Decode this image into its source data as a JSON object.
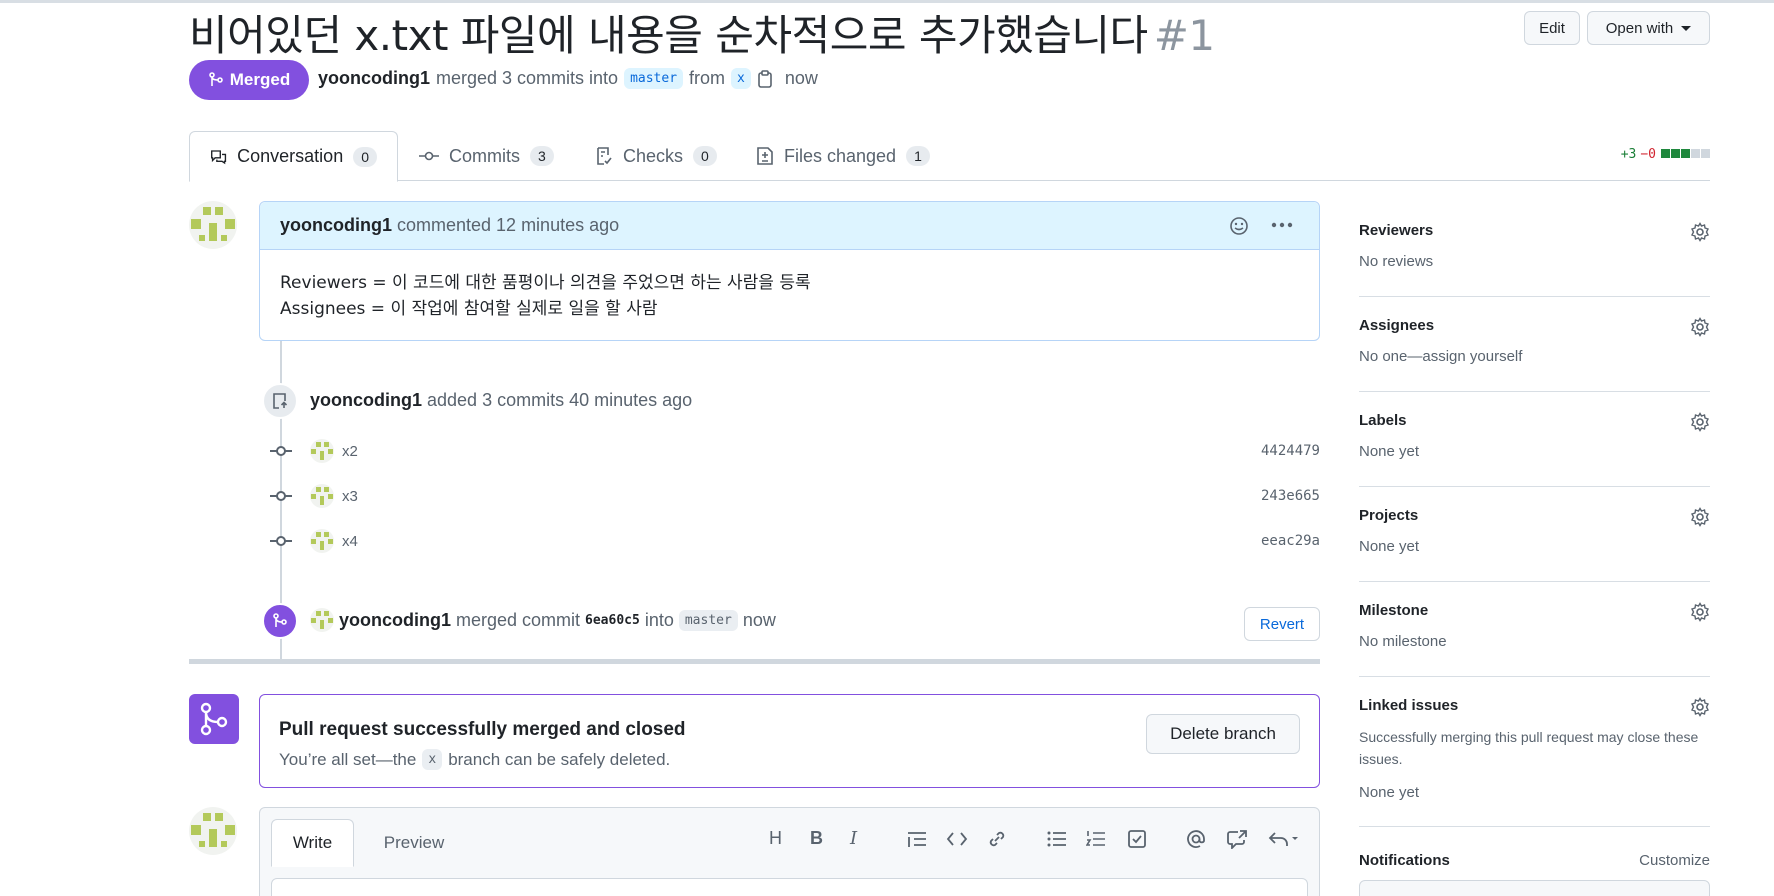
{
  "header": {
    "title": "비어있던 x.txt 파일에 내용을 순차적으로 추가했습니다",
    "number": "#1",
    "edit_label": "Edit",
    "open_with_label": "Open with"
  },
  "status": {
    "badge": "Merged",
    "author": "yooncoding1",
    "merged_text": "merged 3 commits into",
    "base_branch": "master",
    "from_text": "from",
    "head_branch": "x",
    "time": "now"
  },
  "tabs": [
    {
      "label": "Conversation",
      "count": "0"
    },
    {
      "label": "Commits",
      "count": "3"
    },
    {
      "label": "Checks",
      "count": "0"
    },
    {
      "label": "Files changed",
      "count": "1"
    }
  ],
  "diffstat": {
    "additions": "+3",
    "deletions": "−0",
    "green_blocks": 3,
    "gray_blocks": 2,
    "green": "#1f883d",
    "gray": "#d0d7de"
  },
  "comment": {
    "author": "yooncoding1",
    "action": "commented 12 minutes ago",
    "lines": [
      "Reviewers = 이 코드에 대한 품평이나 의견을 주었으면 하는 사람을 등록",
      "Assignees = 이 작업에 참여할 실제로 일을 할 사람"
    ]
  },
  "commits_event": {
    "author": "yooncoding1",
    "text": "added 3 commits 40 minutes ago",
    "commits": [
      {
        "message": "x2",
        "sha": "4424479"
      },
      {
        "message": "x3",
        "sha": "243e665"
      },
      {
        "message": "x4",
        "sha": "eeac29a"
      }
    ]
  },
  "merge_event": {
    "author": "yooncoding1",
    "text1": "merged commit",
    "sha": "6ea60c5",
    "text2": "into",
    "branch": "master",
    "time": "now",
    "revert_label": "Revert"
  },
  "merged_box": {
    "title": "Pull request successfully merged and closed",
    "desc_before": "You’re all set—the",
    "branch": "x",
    "desc_after": "branch can be safely deleted.",
    "delete_label": "Delete branch"
  },
  "editor": {
    "write_tab": "Write",
    "preview_tab": "Preview"
  },
  "sidebar": {
    "reviewers": {
      "title": "Reviewers",
      "value": "No reviews"
    },
    "assignees": {
      "title": "Assignees",
      "value": "No one—assign yourself"
    },
    "labels": {
      "title": "Labels",
      "value": "None yet"
    },
    "projects": {
      "title": "Projects",
      "value": "None yet"
    },
    "milestone": {
      "title": "Milestone",
      "value": "No milestone"
    },
    "linked": {
      "title": "Linked issues",
      "value": "Successfully merging this pull request may close these issues.",
      "value2": "None yet"
    },
    "notifications": {
      "title": "Notifications",
      "customize": "Customize"
    }
  },
  "colors": {
    "accent_purple": "#8250df",
    "link_blue": "#0969da"
  }
}
